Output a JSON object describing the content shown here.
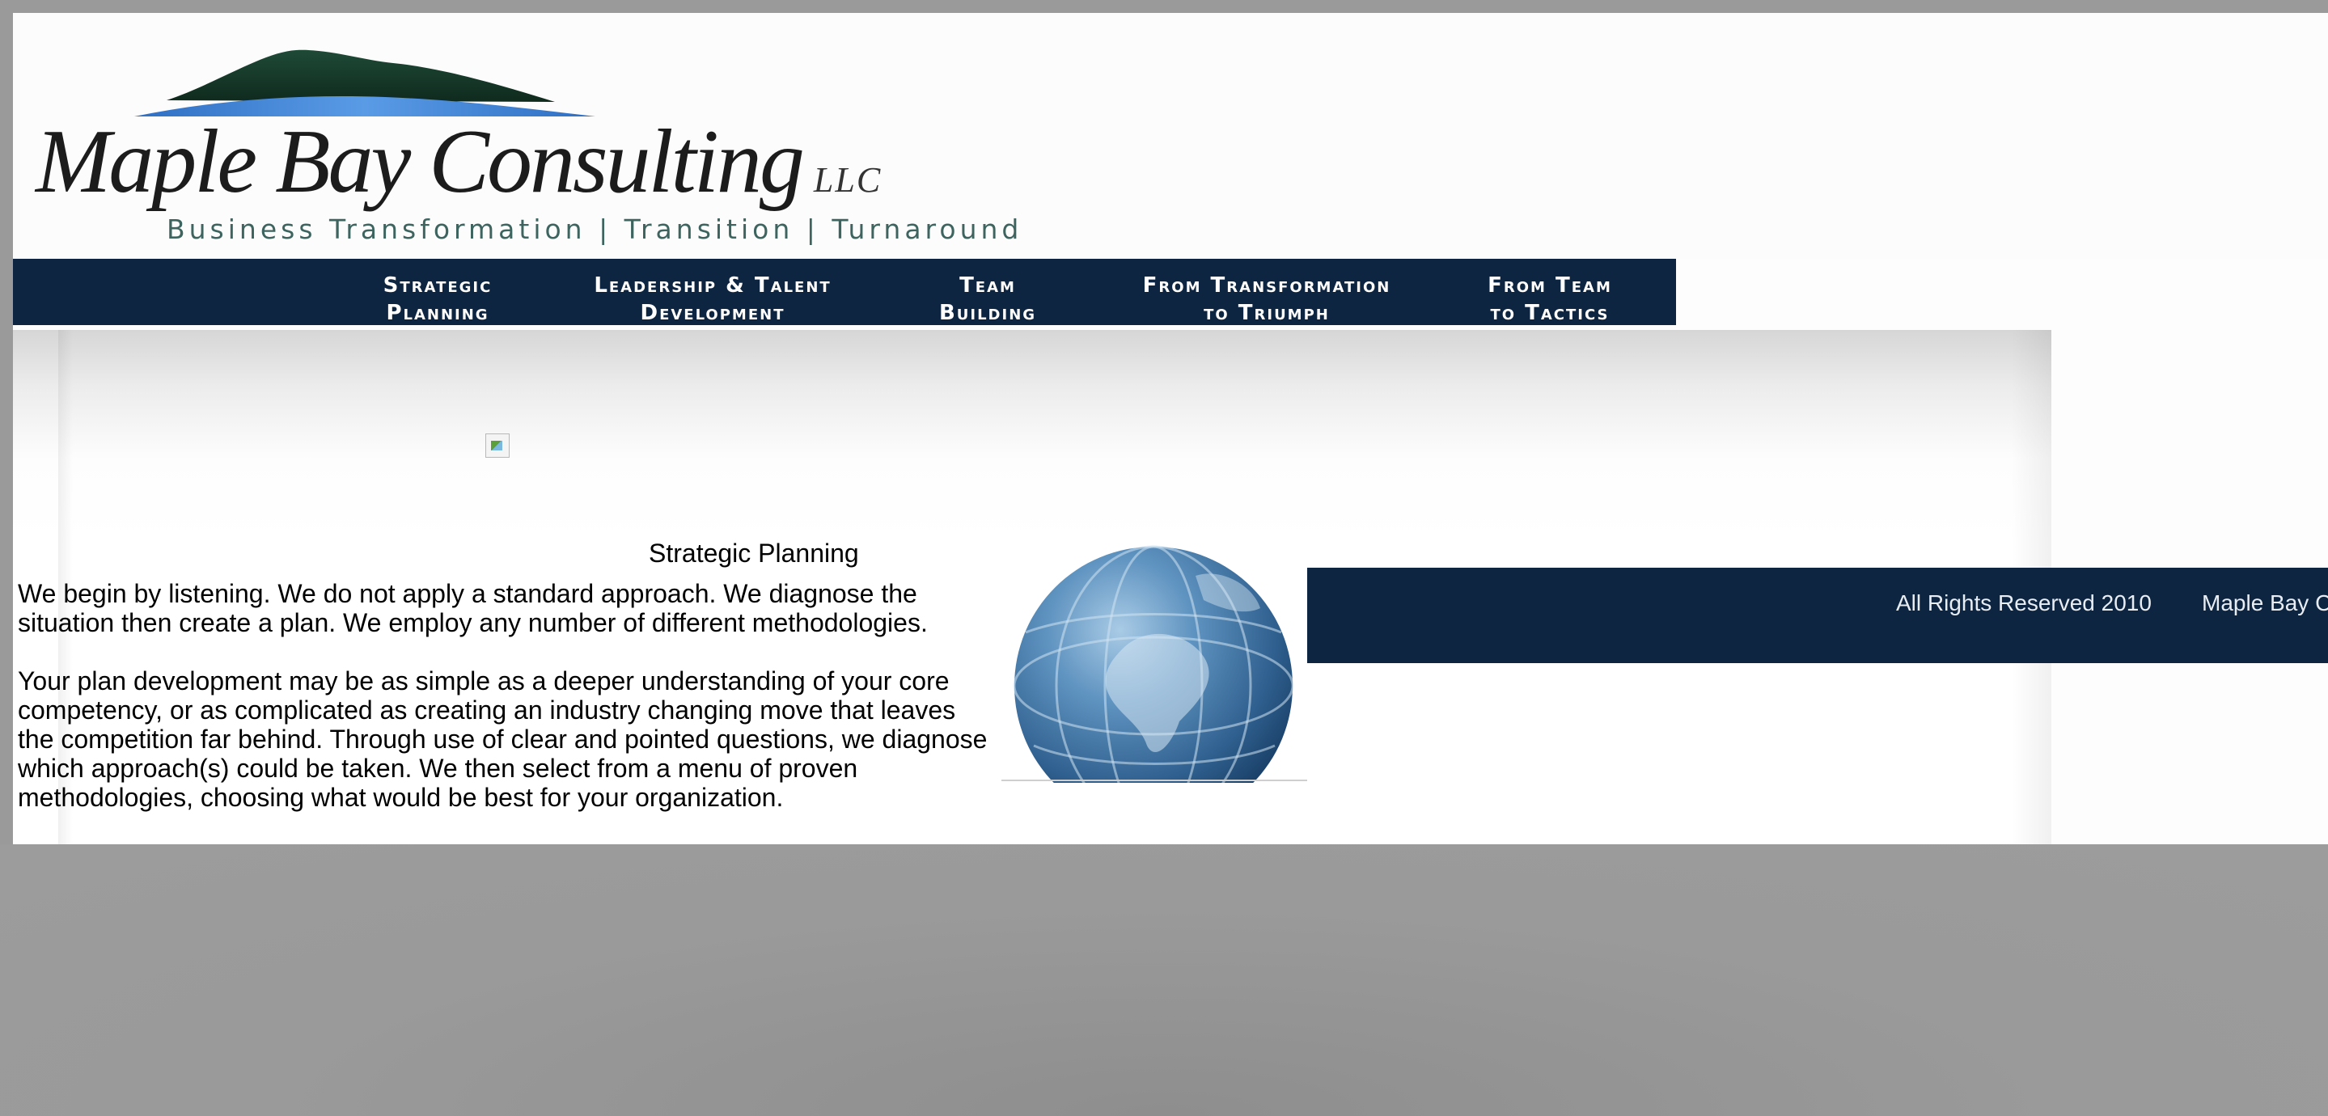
{
  "brand": {
    "name": "Maple Bay Consulting",
    "suffix": "LLC",
    "tagline": "Business Transformation  |  Transition  |  Turnaround"
  },
  "nav": {
    "items": [
      {
        "line1": "Strategic",
        "line2": "Planning"
      },
      {
        "line1": "Leadership & Talent",
        "line2": "Development"
      },
      {
        "line1": "Team",
        "line2": "Building"
      },
      {
        "line1": "From Transformation",
        "line2": "to Triumph"
      },
      {
        "line1": "From Team",
        "line2": "to Tactics"
      }
    ]
  },
  "content": {
    "heading": "Strategic Planning",
    "paragraph1": "We begin by listening. We do not apply a standard approach. We diagnose the situation then create a plan. We employ any number of different methodologies.",
    "paragraph2": "Your plan development may be as simple as a deeper understanding of your core competency, or as complicated as creating an industry changing move that leaves the competition far behind. Through use of clear and pointed questions, we diagnose which approach(s) could be taken. We then select from a menu of proven methodologies, choosing what would be best for your organization."
  },
  "footer": {
    "rights": "All Rights Reserved  2010",
    "company": "Maple Bay Co"
  },
  "colors": {
    "navy": "#0d2541",
    "tagline": "#3e6460",
    "mountain_dark": "#163a2c",
    "water_blue": "#3f7fd0"
  }
}
